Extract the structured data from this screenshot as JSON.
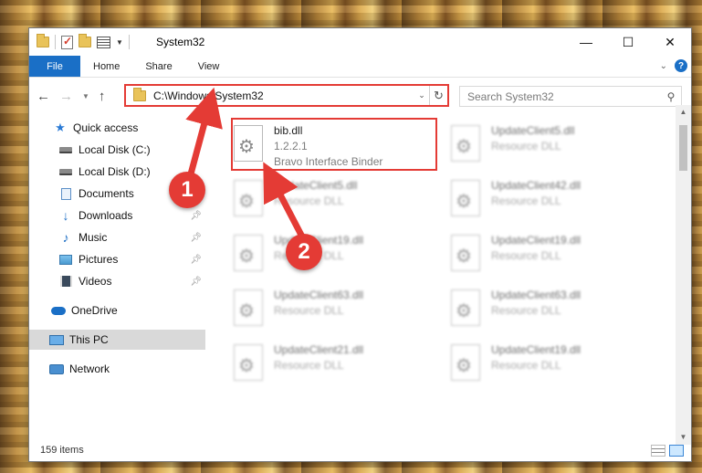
{
  "window": {
    "title": "System32"
  },
  "ribbon": {
    "file_tab": "File",
    "tabs": [
      "Home",
      "Share",
      "View"
    ],
    "help": "?"
  },
  "address": {
    "path": "C:\\Windows\\System32"
  },
  "search": {
    "placeholder": "Search System32"
  },
  "sidebar": {
    "items": [
      {
        "label": "Quick access",
        "icon": "star-icon"
      },
      {
        "label": "Local Disk (C:)",
        "icon": "drive-icon"
      },
      {
        "label": "Local Disk (D:)",
        "icon": "drive-icon"
      },
      {
        "label": "Documents",
        "icon": "documents-icon",
        "pinned": true
      },
      {
        "label": "Downloads",
        "icon": "downloads-icon",
        "pinned": true
      },
      {
        "label": "Music",
        "icon": "music-icon",
        "pinned": true
      },
      {
        "label": "Pictures",
        "icon": "pictures-icon",
        "pinned": true
      },
      {
        "label": "Videos",
        "icon": "videos-icon",
        "pinned": true
      },
      {
        "label": "OneDrive",
        "icon": "onedrive-icon"
      },
      {
        "label": "This PC",
        "icon": "this-pc-icon",
        "selected": true
      },
      {
        "label": "Network",
        "icon": "network-icon"
      }
    ]
  },
  "files": {
    "highlighted": {
      "name": "bib.dll",
      "version": "1.2.2.1",
      "description": "Bravo Interface Binder"
    },
    "blurred": [
      {
        "name": "UpdateClient5.dll",
        "type": "Resource DLL"
      },
      {
        "name": "UpdateClient5.dll",
        "type": "Resource DLL"
      },
      {
        "name": "UpdateClient42.dll",
        "type": "Resource DLL"
      },
      {
        "name": "UpdateClient19.dll",
        "type": "Resource DLL"
      },
      {
        "name": "UpdateClient19.dll",
        "type": "Resource DLL"
      },
      {
        "name": "UpdateClient63.dll",
        "type": "Resource DLL"
      },
      {
        "name": "UpdateClient63.dll",
        "type": "Resource DLL"
      },
      {
        "name": "UpdateClient21.dll",
        "type": "Resource DLL"
      },
      {
        "name": "UpdateClient19.dll",
        "type": "Resource DLL"
      }
    ]
  },
  "status": {
    "item_count": "159 items"
  },
  "annotations": {
    "badge1": "1",
    "badge2": "2",
    "color": "#e43b35"
  }
}
